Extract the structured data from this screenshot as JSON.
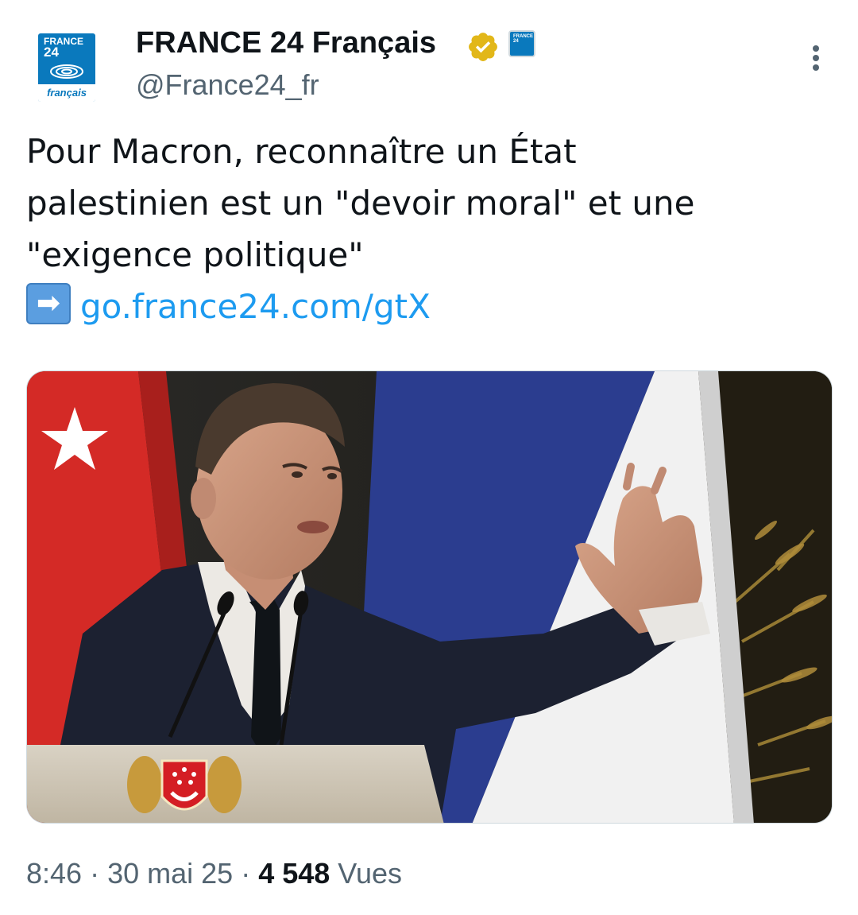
{
  "account": {
    "display_name": "FRANCE 24 Français",
    "handle": "@France24_fr",
    "avatar_text": {
      "top": "FRANCE",
      "number": "24",
      "bottom": "français"
    },
    "affiliate_badge_text": "FRANCE 24",
    "verified_badge_color": "#e2b719"
  },
  "tweet": {
    "lines": [
      "Pour Macron, reconnaître un État",
      "palestinien est un \"devoir moral\" et une",
      "\"exigence politique\""
    ],
    "arrow_icon": "right-arrow-emoji-icon",
    "arrow_glyph": "➡",
    "link_text": "go.france24.com/gtX"
  },
  "media": {
    "image_icon": "press-conference-photo"
  },
  "meta": {
    "time": "8:46",
    "sep1": " · ",
    "date": "30 mai 25",
    "sep2": " · ",
    "views_count": "4 548",
    "views_label": "Vues"
  },
  "colors": {
    "brand_blue": "#0a79bd",
    "link": "#1d9bf0",
    "secondary_text": "#536471",
    "primary_text": "#0f1419"
  }
}
